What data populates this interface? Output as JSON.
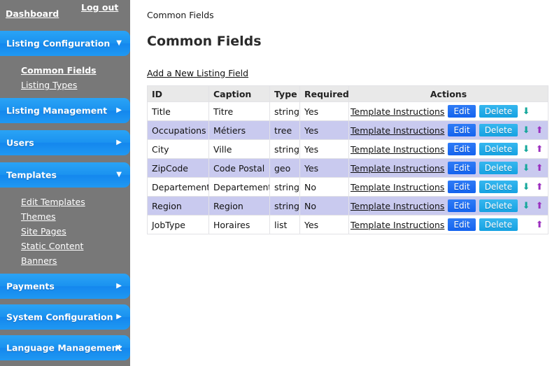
{
  "sidebar": {
    "top_links": [
      {
        "label": "Dashboard",
        "name": "dashboard-link"
      },
      {
        "label": "Log out",
        "name": "logout-link"
      }
    ],
    "menus": [
      {
        "label": "Listing Configuration",
        "expanded": true,
        "icon": "chevron-down-icon"
      },
      {
        "label": "Listing Management",
        "expanded": false,
        "icon": "chevron-right-icon"
      },
      {
        "label": "Users",
        "expanded": false,
        "icon": "chevron-right-icon"
      },
      {
        "label": "Templates",
        "expanded": true,
        "icon": "chevron-down-icon"
      },
      {
        "label": "Payments",
        "expanded": false,
        "icon": "chevron-right-icon"
      },
      {
        "label": "System Configuration",
        "expanded": false,
        "icon": "chevron-right-icon"
      },
      {
        "label": "Language Management",
        "expanded": false,
        "icon": "chevron-right-icon"
      }
    ],
    "listing_config_submenu": [
      {
        "label": "Common Fields",
        "active": true
      },
      {
        "label": "Listing Types",
        "active": false
      }
    ],
    "templates_submenu": [
      {
        "label": "Edit Templates",
        "active": false
      },
      {
        "label": "Themes",
        "active": false
      },
      {
        "label": "Site Pages",
        "active": false
      },
      {
        "label": "Static Content",
        "active": false
      },
      {
        "label": "Banners",
        "active": false
      }
    ]
  },
  "main": {
    "breadcrumb": "Common Fields",
    "page_title": "Common Fields",
    "add_link": "Add a New Listing Field",
    "table": {
      "headers": [
        "ID",
        "Caption",
        "Type",
        "Required",
        "Actions"
      ],
      "row_actions": {
        "template_link": "Template Instructions",
        "edit_label": "Edit",
        "delete_label": "Delete",
        "move_down_icon": "arrow-down-icon",
        "move_up_icon": "arrow-up-icon"
      },
      "rows": [
        {
          "id": "Title",
          "caption": "Titre",
          "type": "string",
          "required": "Yes",
          "move_down": true,
          "move_up": false
        },
        {
          "id": "Occupations",
          "caption": "Métiers",
          "type": "tree",
          "required": "Yes",
          "move_down": true,
          "move_up": true
        },
        {
          "id": "City",
          "caption": "Ville",
          "type": "string",
          "required": "Yes",
          "move_down": true,
          "move_up": true
        },
        {
          "id": "ZipCode",
          "caption": "Code Postal",
          "type": "geo",
          "required": "Yes",
          "move_down": true,
          "move_up": true
        },
        {
          "id": "Departement",
          "caption": "Departement",
          "type": "string",
          "required": "No",
          "move_down": true,
          "move_up": true
        },
        {
          "id": "Region",
          "caption": "Region",
          "type": "string",
          "required": "No",
          "move_down": true,
          "move_up": true
        },
        {
          "id": "JobType",
          "caption": "Horaires",
          "type": "list",
          "required": "Yes",
          "move_down": false,
          "move_up": true
        }
      ]
    }
  },
  "colors": {
    "sidebar_bg": "#787878",
    "nav_blue": "#1b93f0",
    "edit_blue": "#1463ef",
    "delete_blue": "#16a2e2",
    "row_alt": "#c9caef",
    "header_gray": "#e9e9e9",
    "arrow_down": "#15a79b",
    "arrow_up": "#9b2fbf"
  }
}
